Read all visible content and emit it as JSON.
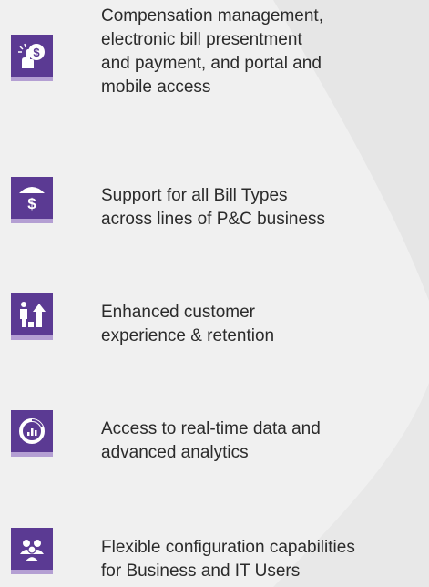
{
  "colors": {
    "background": "#f0f0f0",
    "icon_box": "#5b3a93",
    "icon_underline": "#b49fd3",
    "text": "#2b2b2b"
  },
  "features": [
    {
      "icon": "touch-payment-icon",
      "text": "Compensation management,\nelectronic bill presentment\nand payment, and portal and\nmobile access"
    },
    {
      "icon": "umbrella-dollar-icon",
      "text": "Support for all Bill Types\nacross lines of P&C business"
    },
    {
      "icon": "customer-growth-icon",
      "text": "Enhanced customer\nexperience & retention"
    },
    {
      "icon": "analytics-gauge-icon",
      "text": "Access to real-time data and\nadvanced analytics"
    },
    {
      "icon": "users-group-icon",
      "text": "Flexible configuration capabilities\nfor  Business and IT Users"
    }
  ]
}
